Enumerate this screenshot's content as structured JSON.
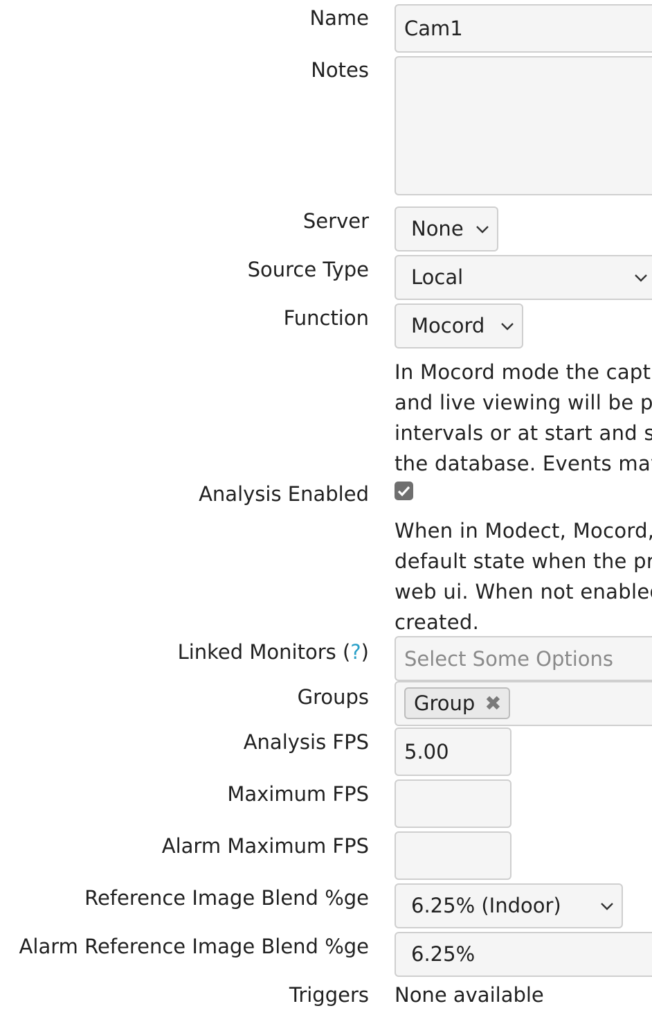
{
  "form": {
    "name": {
      "label": "Name",
      "value": "Cam1"
    },
    "notes": {
      "label": "Notes",
      "value": ""
    },
    "server": {
      "label": "Server",
      "selected": "None"
    },
    "source_type": {
      "label": "Source Type",
      "selected": "Local"
    },
    "function": {
      "label": "Function",
      "selected": "Mocord",
      "help_lines": [
        "In Mocord mode the capt",
        "and live viewing will be p",
        "intervals or at start and s",
        "the database. Events may"
      ]
    },
    "analysis_enabled": {
      "label": "Analysis Enabled",
      "checked": true,
      "help_lines": [
        "When in Modect, Mocord,",
        "default state when the pr",
        "web ui. When not enabled",
        "created."
      ]
    },
    "linked_monitors": {
      "label": "Linked Monitors (",
      "help_mark": "?",
      "label_end": ")",
      "placeholder": "Select Some Options"
    },
    "groups": {
      "label": "Groups",
      "chip": "Group",
      "chip_remove": "✖"
    },
    "analysis_fps": {
      "label": "Analysis FPS",
      "value": "5.00"
    },
    "maximum_fps": {
      "label": "Maximum FPS",
      "value": ""
    },
    "alarm_maximum_fps": {
      "label": "Alarm Maximum FPS",
      "value": ""
    },
    "ref_blend": {
      "label": "Reference Image Blend %ge",
      "selected": "6.25% (Indoor)"
    },
    "alarm_ref_blend": {
      "label": "Alarm Reference Image Blend %ge",
      "selected": "6.25%"
    },
    "triggers": {
      "label": "Triggers",
      "value": "None available"
    }
  },
  "icons": {
    "dropdown": "chevron-down-icon",
    "check": "checkmark-icon",
    "remove": "close-icon"
  }
}
